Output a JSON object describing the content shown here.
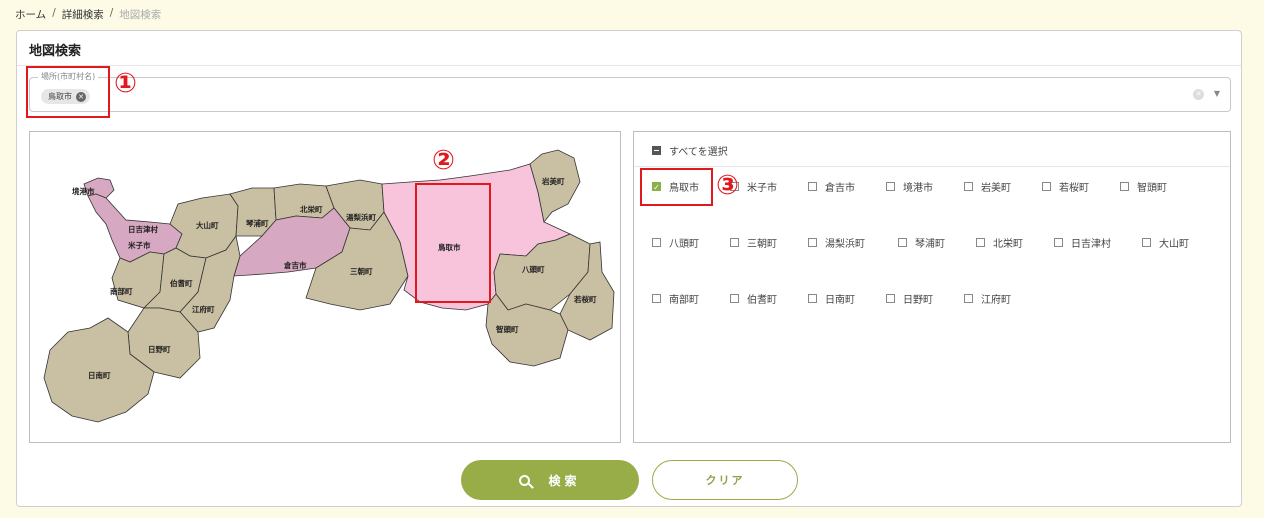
{
  "breadcrumb": {
    "home": "ホーム",
    "detail": "詳細検索",
    "current": "地図検索",
    "separator": "/"
  },
  "panel": {
    "title": "地図検索"
  },
  "location": {
    "label": "場所(市町村名)",
    "chip": "鳥取市",
    "chip_remove_icon": "close-circle-icon",
    "clear_icon": "clear-circle-icon",
    "dropdown_icon": "chevron-down-icon"
  },
  "map": {
    "labels": {
      "sakaiminato": "境港市",
      "hiezu": "日吉津村",
      "yonago": "米子市",
      "daisen": "大山町",
      "kotoura": "琴浦町",
      "hokuei": "北栄町",
      "yurihama": "湯梨浜町",
      "tottori": "鳥取市",
      "iwami": "岩美町",
      "kurayoshi": "倉吉市",
      "misasa": "三朝町",
      "yazu": "八頭町",
      "wakasa": "若桜町",
      "chizu": "智頭町",
      "nanbu": "南部町",
      "hoki": "伯耆町",
      "kofu": "江府町",
      "hino": "日野町",
      "nichinan": "日南町"
    },
    "colors": {
      "default": "#c9bfa2",
      "selected_region": "#f7c4dc",
      "highlight": "#d7a8c1"
    }
  },
  "checklist": {
    "select_all": "すべてを選択",
    "rows": [
      [
        "鳥取市",
        "米子市",
        "倉吉市",
        "境港市",
        "岩美町",
        "若桜町",
        "智頭町"
      ],
      [
        "八頭町",
        "三朝町",
        "湯梨浜町",
        "琴浦町",
        "北栄町",
        "日吉津村",
        "大山町"
      ],
      [
        "南部町",
        "伯耆町",
        "日南町",
        "日野町",
        "江府町"
      ]
    ],
    "checked": [
      "鳥取市"
    ]
  },
  "annotations": {
    "one": "①",
    "two": "②",
    "three": "③",
    "color": "#e0191e"
  },
  "buttons": {
    "search": "検索",
    "clear": "クリア",
    "accent": "#98ac48"
  }
}
